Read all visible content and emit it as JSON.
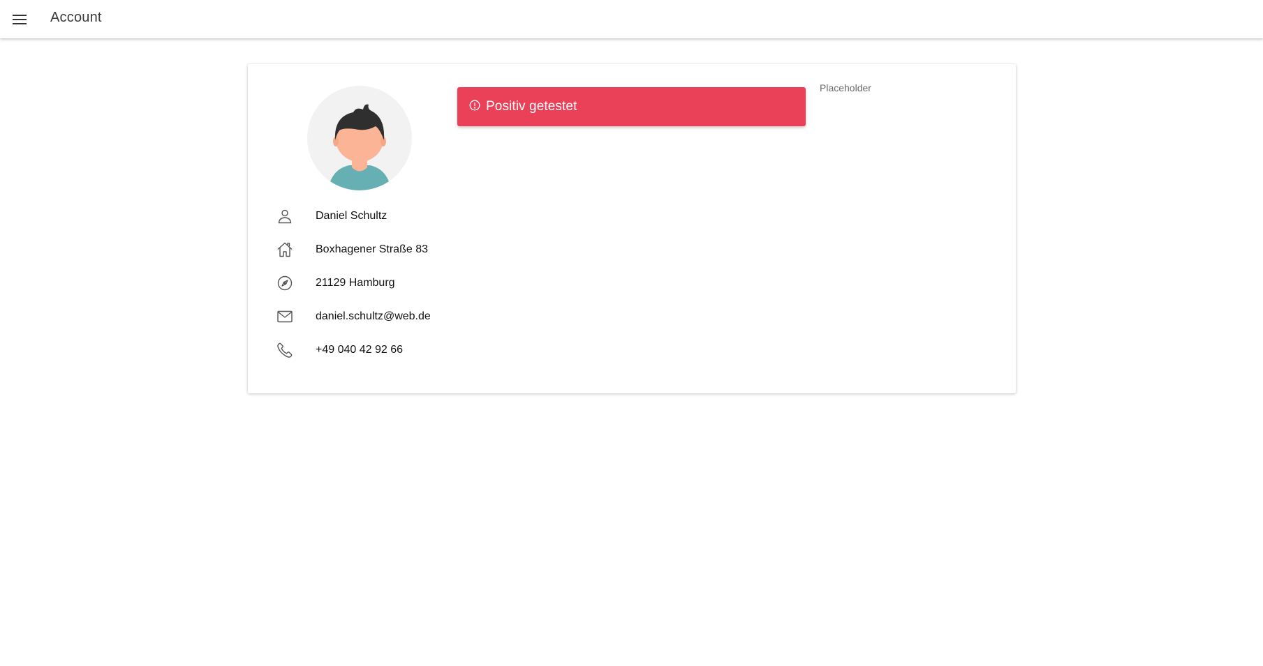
{
  "header": {
    "menu_icon": "menu-icon",
    "title": "Account"
  },
  "profile": {
    "avatar": "avatar-illustration",
    "name": "Daniel Schultz",
    "street": "Boxhagener Straße 83",
    "city": "21129 Hamburg",
    "email": "daniel.schultz@web.de",
    "phone": "+49 040 42 92 66"
  },
  "icons": {
    "name": "person-icon",
    "street": "home-icon",
    "city": "compass-icon",
    "email": "mail-icon",
    "phone": "phone-icon",
    "alert": "alert-circle-icon"
  },
  "status": {
    "label": "Positiv getestet",
    "color": "#ea4058"
  },
  "side": {
    "placeholder": "Placeholder"
  }
}
